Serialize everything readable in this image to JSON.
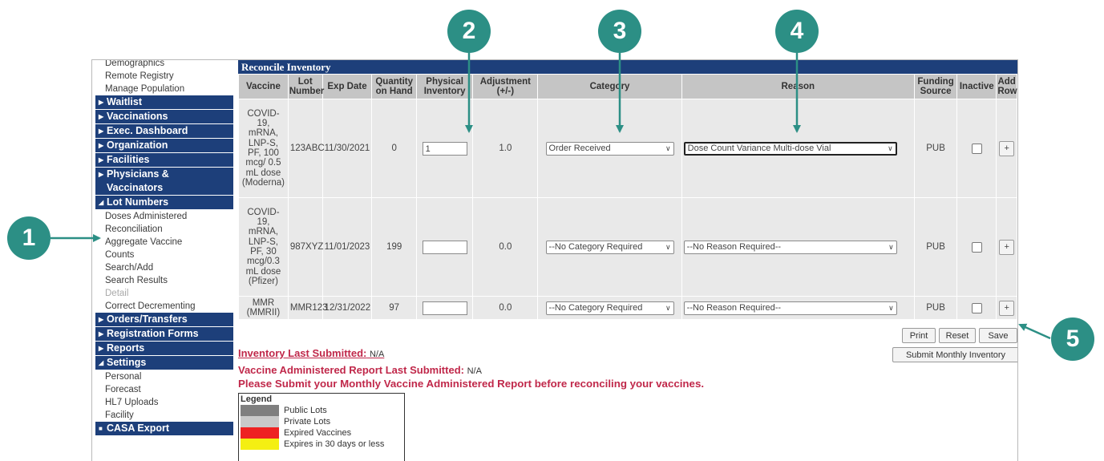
{
  "sidebar": {
    "top_links": [
      "Demographics",
      "Remote Registry",
      "Manage Population"
    ],
    "sections_a": [
      "Waitlist",
      "Vaccinations",
      "Exec. Dashboard",
      "Organization",
      "Facilities"
    ],
    "physicians": [
      "Physicians &",
      "Vaccinators"
    ],
    "lot_numbers": "Lot Numbers",
    "lot_links": [
      "Doses Administered",
      "Reconciliation",
      "Aggregate Vaccine",
      "Counts",
      "Search/Add",
      "Search Results",
      "Detail",
      "Correct Decrementing"
    ],
    "sections_b": [
      "Orders/Transfers",
      "Registration Forms",
      "Reports"
    ],
    "settings": "Settings",
    "settings_links": [
      "Personal",
      "Forecast",
      "HL7 Uploads",
      "Facility"
    ],
    "casa": "CASA Export",
    "arrow_right": "▶",
    "arrow_down": "◢",
    "square": "■"
  },
  "main": {
    "title": "Reconcile Inventory",
    "headers": {
      "vaccine": "Vaccine",
      "lot": [
        "Lot",
        "Number"
      ],
      "exp": "Exp Date",
      "qoh": [
        "Quantity",
        "on Hand"
      ],
      "physical": [
        "Physical",
        "Inventory"
      ],
      "adjustment": [
        "Adjustment",
        "(+/-)"
      ],
      "category": "Category",
      "reason": "Reason",
      "funding": [
        "Funding",
        "Source"
      ],
      "inactive": "Inactive",
      "add": [
        "Add",
        "Row"
      ]
    },
    "rows": [
      {
        "vaccine": [
          "COVID-",
          "19,",
          "mRNA,",
          "LNP-S,",
          "PF, 100",
          "mcg/ 0.5",
          "mL dose",
          "(Moderna)"
        ],
        "lot": "123ABC",
        "exp": "11/30/2021",
        "qoh": "0",
        "physical": "1",
        "adjustment": "1.0",
        "category": "Order Received",
        "reason": "Dose Count Variance Multi-dose Vial",
        "funding": "PUB",
        "add": "+"
      },
      {
        "vaccine": [
          "COVID-",
          "19,",
          "mRNA,",
          "LNP-S,",
          "PF, 30",
          "mcg/0.3",
          "mL dose",
          "(Pfizer)"
        ],
        "lot": "987XYZ",
        "exp": "11/01/2023",
        "qoh": "199",
        "physical": "",
        "adjustment": "0.0",
        "category": "--No Category Required",
        "reason": "--No Reason Required--",
        "funding": "PUB",
        "add": "+"
      },
      {
        "vaccine": [
          "MMR",
          "(MMRII)"
        ],
        "lot": "MMR123",
        "exp": "12/31/2022",
        "qoh": "97",
        "physical": "",
        "adjustment": "0.0",
        "category": "--No Category Required",
        "reason": "--No Reason Required--",
        "funding": "PUB",
        "add": "+"
      }
    ],
    "buttons": {
      "print": "Print",
      "reset": "Reset",
      "save": "Save",
      "submit": "Submit Monthly Inventory"
    },
    "inventory_label": "Inventory Last Submitted:",
    "inventory_value": "N/A",
    "vaccine_report_label": "Vaccine Administered Report Last Submitted:",
    "vaccine_report_value": "N/A",
    "warning": "Please Submit your Monthly Vaccine Administered Report before reconciling your vaccines.",
    "legend": {
      "title": "Legend",
      "items": [
        {
          "label": "Public Lots",
          "color": "#7f7f7f"
        },
        {
          "label": "Private Lots",
          "color": "#c9c9c9"
        },
        {
          "label": "Expired Vaccines",
          "color": "#ee2222"
        },
        {
          "label": "Expires in 30 days or less",
          "color": "#f4ef12"
        }
      ]
    }
  },
  "callouts": [
    "1",
    "2",
    "3",
    "4",
    "5"
  ],
  "colors": {
    "accent": "#2c8f85",
    "nav": "#1d3f7a",
    "alert": "#c0284a"
  }
}
